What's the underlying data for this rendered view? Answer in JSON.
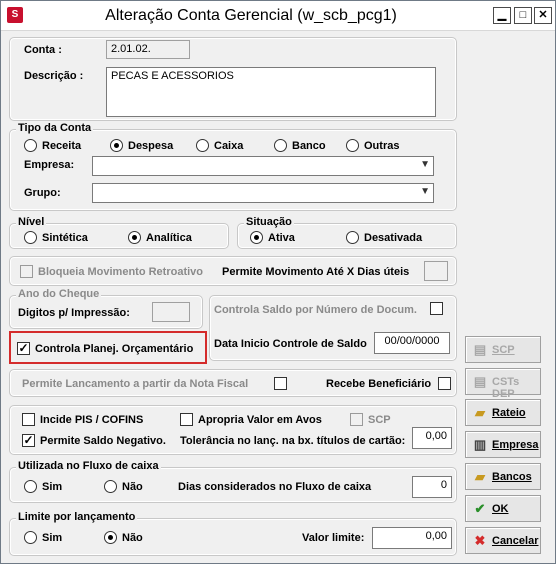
{
  "window": {
    "title": "Alteração Conta Gerencial (w_scb_pcg1)"
  },
  "conta": {
    "label": "Conta :",
    "value": "2.01.02.",
    "desc_label": "Descrição :",
    "desc_value": "PECAS E ACESSORIOS"
  },
  "tipo_conta": {
    "legend": "Tipo da Conta",
    "options": [
      "Receita",
      "Despesa",
      "Caixa",
      "Banco",
      "Outras"
    ],
    "selected": "Despesa",
    "empresa_label": "Empresa:",
    "grupo_label": "Grupo:"
  },
  "nivel": {
    "legend": "Nível",
    "options": [
      "Sintética",
      "Analítica"
    ],
    "selected": "Analítica"
  },
  "situacao": {
    "legend": "Situação",
    "options": [
      "Ativa",
      "Desativada"
    ],
    "selected": "Ativa"
  },
  "bloqueia": {
    "label": "Bloqueia Movimento Retroativo",
    "permite_label": "Permite Movimento Até X Dias úteis"
  },
  "ano_cheque": {
    "legend": "Ano do Cheque",
    "digitos_label": "Digitos p/ Impressão:"
  },
  "controla_saldo": {
    "label": "Controla  Saldo por Número de Docum.",
    "data_label": "Data Inicio Controle de Saldo",
    "data_value": "00/00/0000"
  },
  "planej": {
    "label": "Controla Planej. Orçamentário",
    "checked": true
  },
  "nota": {
    "label": "Permite Lancamento a partir da Nota Fiscal",
    "benef_label": "Recebe Beneficiário"
  },
  "flags": {
    "pis_label": "Incide PIS / COFINS",
    "apropria_label": "Apropria Valor em Avos",
    "scp_label": "SCP",
    "saldo_neg_label": "Permite Saldo Negativo.",
    "tolerancia_label": "Tolerância no lanç. na bx. títulos de cartão:",
    "tolerancia_value": "0,00"
  },
  "fluxo": {
    "legend": "Utilizada no Fluxo de caixa",
    "options": [
      "Sim",
      "Não"
    ],
    "dias_label": "Dias considerados no Fluxo de caixa",
    "dias_value": "0"
  },
  "limite": {
    "legend": "Limite por lançamento",
    "options": [
      "Sim",
      "Não"
    ],
    "selected": "Não",
    "valor_label": "Valor limite:",
    "valor_value": "0,00"
  },
  "buttons": {
    "scp": "SCP",
    "csts": "CSTs DEP",
    "rateio": "Rateio",
    "empresa": "Empresa",
    "bancos": "Bancos",
    "ok": "OK",
    "cancelar": "Cancelar"
  },
  "colors": {
    "highlight": "#d42b2b",
    "window_bg": "#f0f0f0"
  }
}
